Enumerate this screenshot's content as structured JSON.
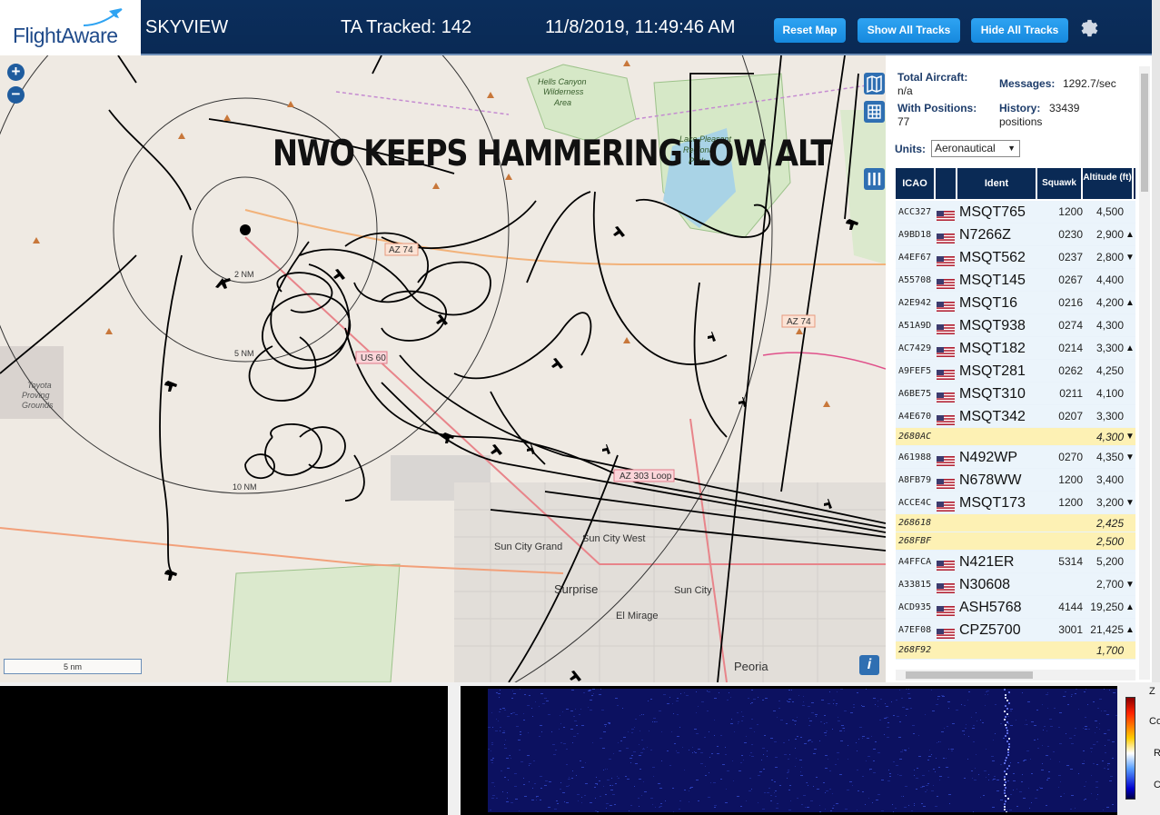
{
  "header": {
    "logo_text": "FlightAware",
    "app_name": "SKYVIEW",
    "ta_tracked": "TA Tracked: 142",
    "datetime": "11/8/2019, 11:49:46 AM",
    "reset_map_label": "Reset Map",
    "show_all_label": "Show All Tracks",
    "hide_all_label": "Hide All Tracks"
  },
  "map": {
    "overlay_title": "NWO KEEPS HAMMERING LOW ALT",
    "scale_label": "5 nm",
    "range_rings": [
      "2 NM",
      "5 NM",
      "10 NM"
    ],
    "place_labels": [
      "Hells Canyon Wilderness Area",
      "Lake Pleasant Regional Park",
      "Toyota Proving Grounds",
      "Sun City Grand",
      "Sun City West",
      "Surprise",
      "Sun City",
      "El Mirage",
      "Peoria"
    ],
    "road_labels": [
      "AZ 74",
      "AZ 74",
      "US 60",
      "AZ 303 Loop"
    ],
    "zoom_in_label": "+",
    "zoom_out_label": "−",
    "info_label": "i"
  },
  "stats": {
    "total_aircraft_label": "Total Aircraft:",
    "total_aircraft_value": "n/a",
    "with_positions_label": "With Positions:",
    "with_positions_value": "77",
    "messages_label": "Messages:",
    "messages_value": "1292.7/sec",
    "history_label": "History:",
    "history_value": "33439",
    "history_unit": "positions",
    "units_label": "Units:",
    "units_value": "Aeronautical"
  },
  "table": {
    "columns": [
      "ICAO",
      "Ident",
      "Squawk",
      "Altitude (ft)"
    ],
    "rows": [
      {
        "icao": "ACC327",
        "flag": true,
        "ident": "MSQT765",
        "squawk": "1200",
        "alt": "4,500",
        "dir": "",
        "tisb": false
      },
      {
        "icao": "A9BD18",
        "flag": true,
        "ident": "N7266Z",
        "squawk": "0230",
        "alt": "2,900",
        "dir": "▲",
        "tisb": false
      },
      {
        "icao": "A4EF67",
        "flag": true,
        "ident": "MSQT562",
        "squawk": "0237",
        "alt": "2,800",
        "dir": "▼",
        "tisb": false
      },
      {
        "icao": "A55708",
        "flag": true,
        "ident": "MSQT145",
        "squawk": "0267",
        "alt": "4,400",
        "dir": "",
        "tisb": false
      },
      {
        "icao": "A2E942",
        "flag": true,
        "ident": "MSQT16",
        "squawk": "0216",
        "alt": "4,200",
        "dir": "▲",
        "tisb": false
      },
      {
        "icao": "A51A9D",
        "flag": true,
        "ident": "MSQT938",
        "squawk": "0274",
        "alt": "4,300",
        "dir": "",
        "tisb": false
      },
      {
        "icao": "AC7429",
        "flag": true,
        "ident": "MSQT182",
        "squawk": "0214",
        "alt": "3,300",
        "dir": "▲",
        "tisb": false
      },
      {
        "icao": "A9FEF5",
        "flag": true,
        "ident": "MSQT281",
        "squawk": "0262",
        "alt": "4,250",
        "dir": "",
        "tisb": false
      },
      {
        "icao": "A6BE75",
        "flag": true,
        "ident": "MSQT310",
        "squawk": "0211",
        "alt": "4,100",
        "dir": "",
        "tisb": false
      },
      {
        "icao": "A4E670",
        "flag": true,
        "ident": "MSQT342",
        "squawk": "0207",
        "alt": "3,300",
        "dir": "",
        "tisb": false
      },
      {
        "icao": "2680AC",
        "flag": false,
        "ident": "",
        "squawk": "",
        "alt": "4,300",
        "dir": "▼",
        "tisb": true
      },
      {
        "icao": "A61988",
        "flag": true,
        "ident": "N492WP",
        "squawk": "0270",
        "alt": "4,350",
        "dir": "▼",
        "tisb": false
      },
      {
        "icao": "A8FB79",
        "flag": true,
        "ident": "N678WW",
        "squawk": "1200",
        "alt": "3,400",
        "dir": "",
        "tisb": false
      },
      {
        "icao": "ACCE4C",
        "flag": true,
        "ident": "MSQT173",
        "squawk": "1200",
        "alt": "3,200",
        "dir": "▼",
        "tisb": false
      },
      {
        "icao": "268618",
        "flag": false,
        "ident": "",
        "squawk": "",
        "alt": "2,425",
        "dir": "",
        "tisb": true
      },
      {
        "icao": "268FBF",
        "flag": false,
        "ident": "",
        "squawk": "",
        "alt": "2,500",
        "dir": "",
        "tisb": true
      },
      {
        "icao": "A4FFCA",
        "flag": true,
        "ident": "N421ER",
        "squawk": "5314",
        "alt": "5,200",
        "dir": "",
        "tisb": false
      },
      {
        "icao": "A33815",
        "flag": true,
        "ident": "N30608",
        "squawk": "",
        "alt": "2,700",
        "dir": "▼",
        "tisb": false
      },
      {
        "icao": "ACD935",
        "flag": true,
        "ident": "ASH5768",
        "squawk": "4144",
        "alt": "19,250",
        "dir": "▲",
        "tisb": false
      },
      {
        "icao": "A7EF08",
        "flag": true,
        "ident": "CPZ5700",
        "squawk": "3001",
        "alt": "21,425",
        "dir": "▲",
        "tisb": false
      },
      {
        "icao": "268F92",
        "flag": false,
        "ident": "",
        "squawk": "",
        "alt": "1,700",
        "dir": "",
        "tisb": true
      }
    ]
  },
  "waterfall": {
    "side_labels": [
      "Z",
      "Co",
      "R",
      "C"
    ]
  },
  "colors": {
    "header_bg": "#0a2a55",
    "button_blue": "#1e90ff",
    "row_blue": "#ebf4fb",
    "row_yellow": "#fdf1b4",
    "track": "#000000"
  }
}
